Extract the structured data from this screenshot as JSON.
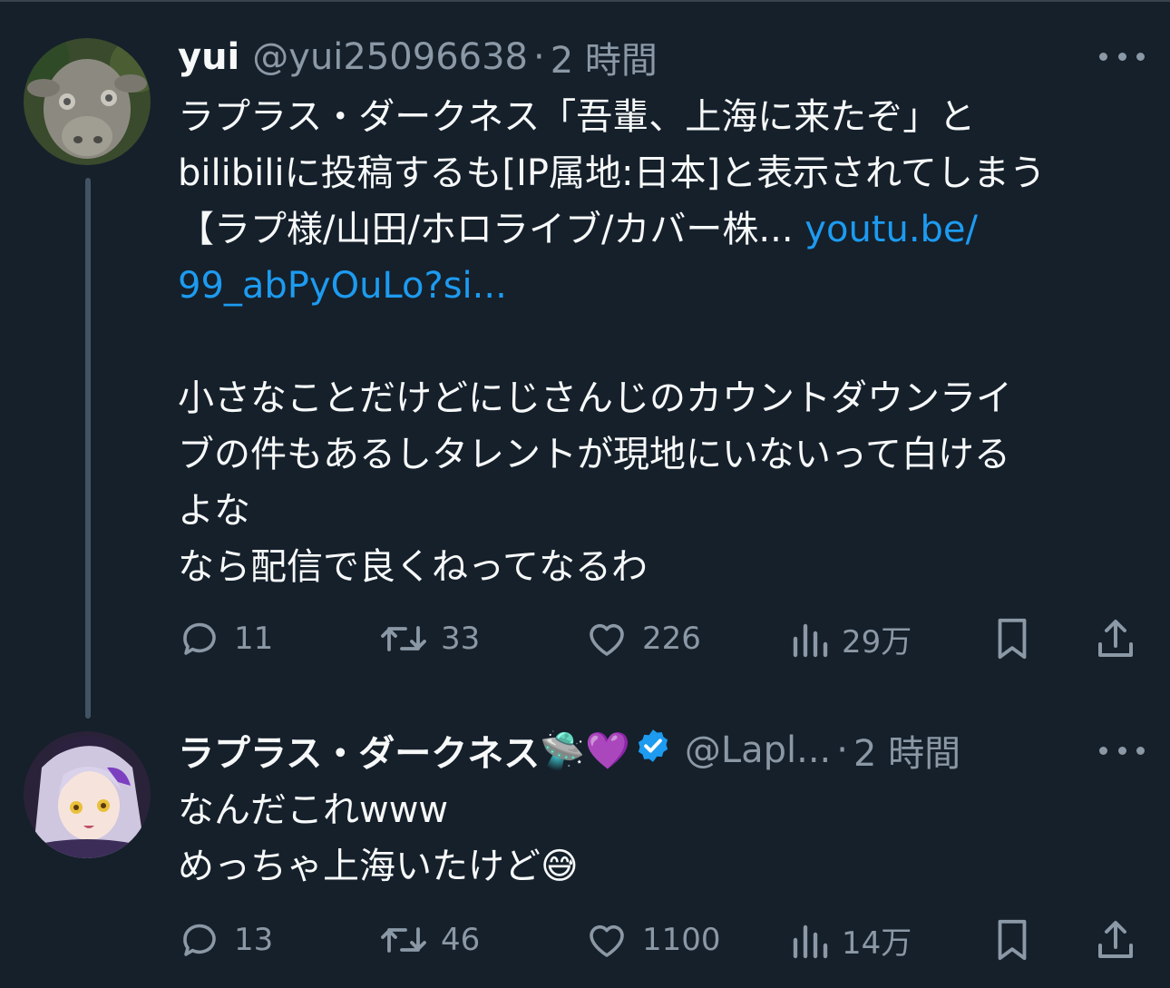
{
  "tweets": [
    {
      "name": "yui",
      "handle": "@yui25096638",
      "dot": "·",
      "time": "2 時間",
      "lines": [
        {
          "text": "ラプラス・ダークネス「吾輩、上海に来たぞ」と",
          "link": ""
        },
        {
          "text": "bilibiliに投稿するも[IP属地:日本]と表示されてしまう",
          "link": ""
        },
        {
          "text": "【ラプ様/山田/ホロライブ/カバー株... ",
          "link": "youtu.be/"
        },
        {
          "text": "",
          "link": "99_abPyOuLo?si..."
        },
        {
          "text": "",
          "link": ""
        },
        {
          "text": "小さなことだけどにじさんじのカウントダウンライ",
          "link": ""
        },
        {
          "text": "ブの件もあるしタレントが現地にいないって白ける",
          "link": ""
        },
        {
          "text": "よな",
          "link": ""
        },
        {
          "text": "なら配信で良くねってなるわ",
          "link": ""
        }
      ],
      "replies": "11",
      "retweets": "33",
      "likes": "226",
      "views": "29万"
    },
    {
      "name": "ラプラス・ダークネス",
      "name_emoji": "🛸💜",
      "handle": "@Lapl...",
      "dot": "·",
      "time": "2 時間",
      "lines": [
        {
          "text": "なんだこれwww",
          "link": ""
        },
        {
          "text": "めっちゃ上海いたけど😅",
          "link": ""
        }
      ],
      "replies": "13",
      "retweets": "46",
      "likes": "1100",
      "views": "14万"
    }
  ],
  "icons": [
    "more-icon",
    "reply-icon",
    "retweet-icon",
    "like-icon",
    "views-icon",
    "bookmark-icon",
    "share-icon",
    "verified-badge-icon"
  ],
  "colors": {
    "background": "#15202b",
    "text": "#f7f9f9",
    "muted": "#8b98a5",
    "link": "#1d9bf0",
    "verified": "#1d9bf0"
  }
}
